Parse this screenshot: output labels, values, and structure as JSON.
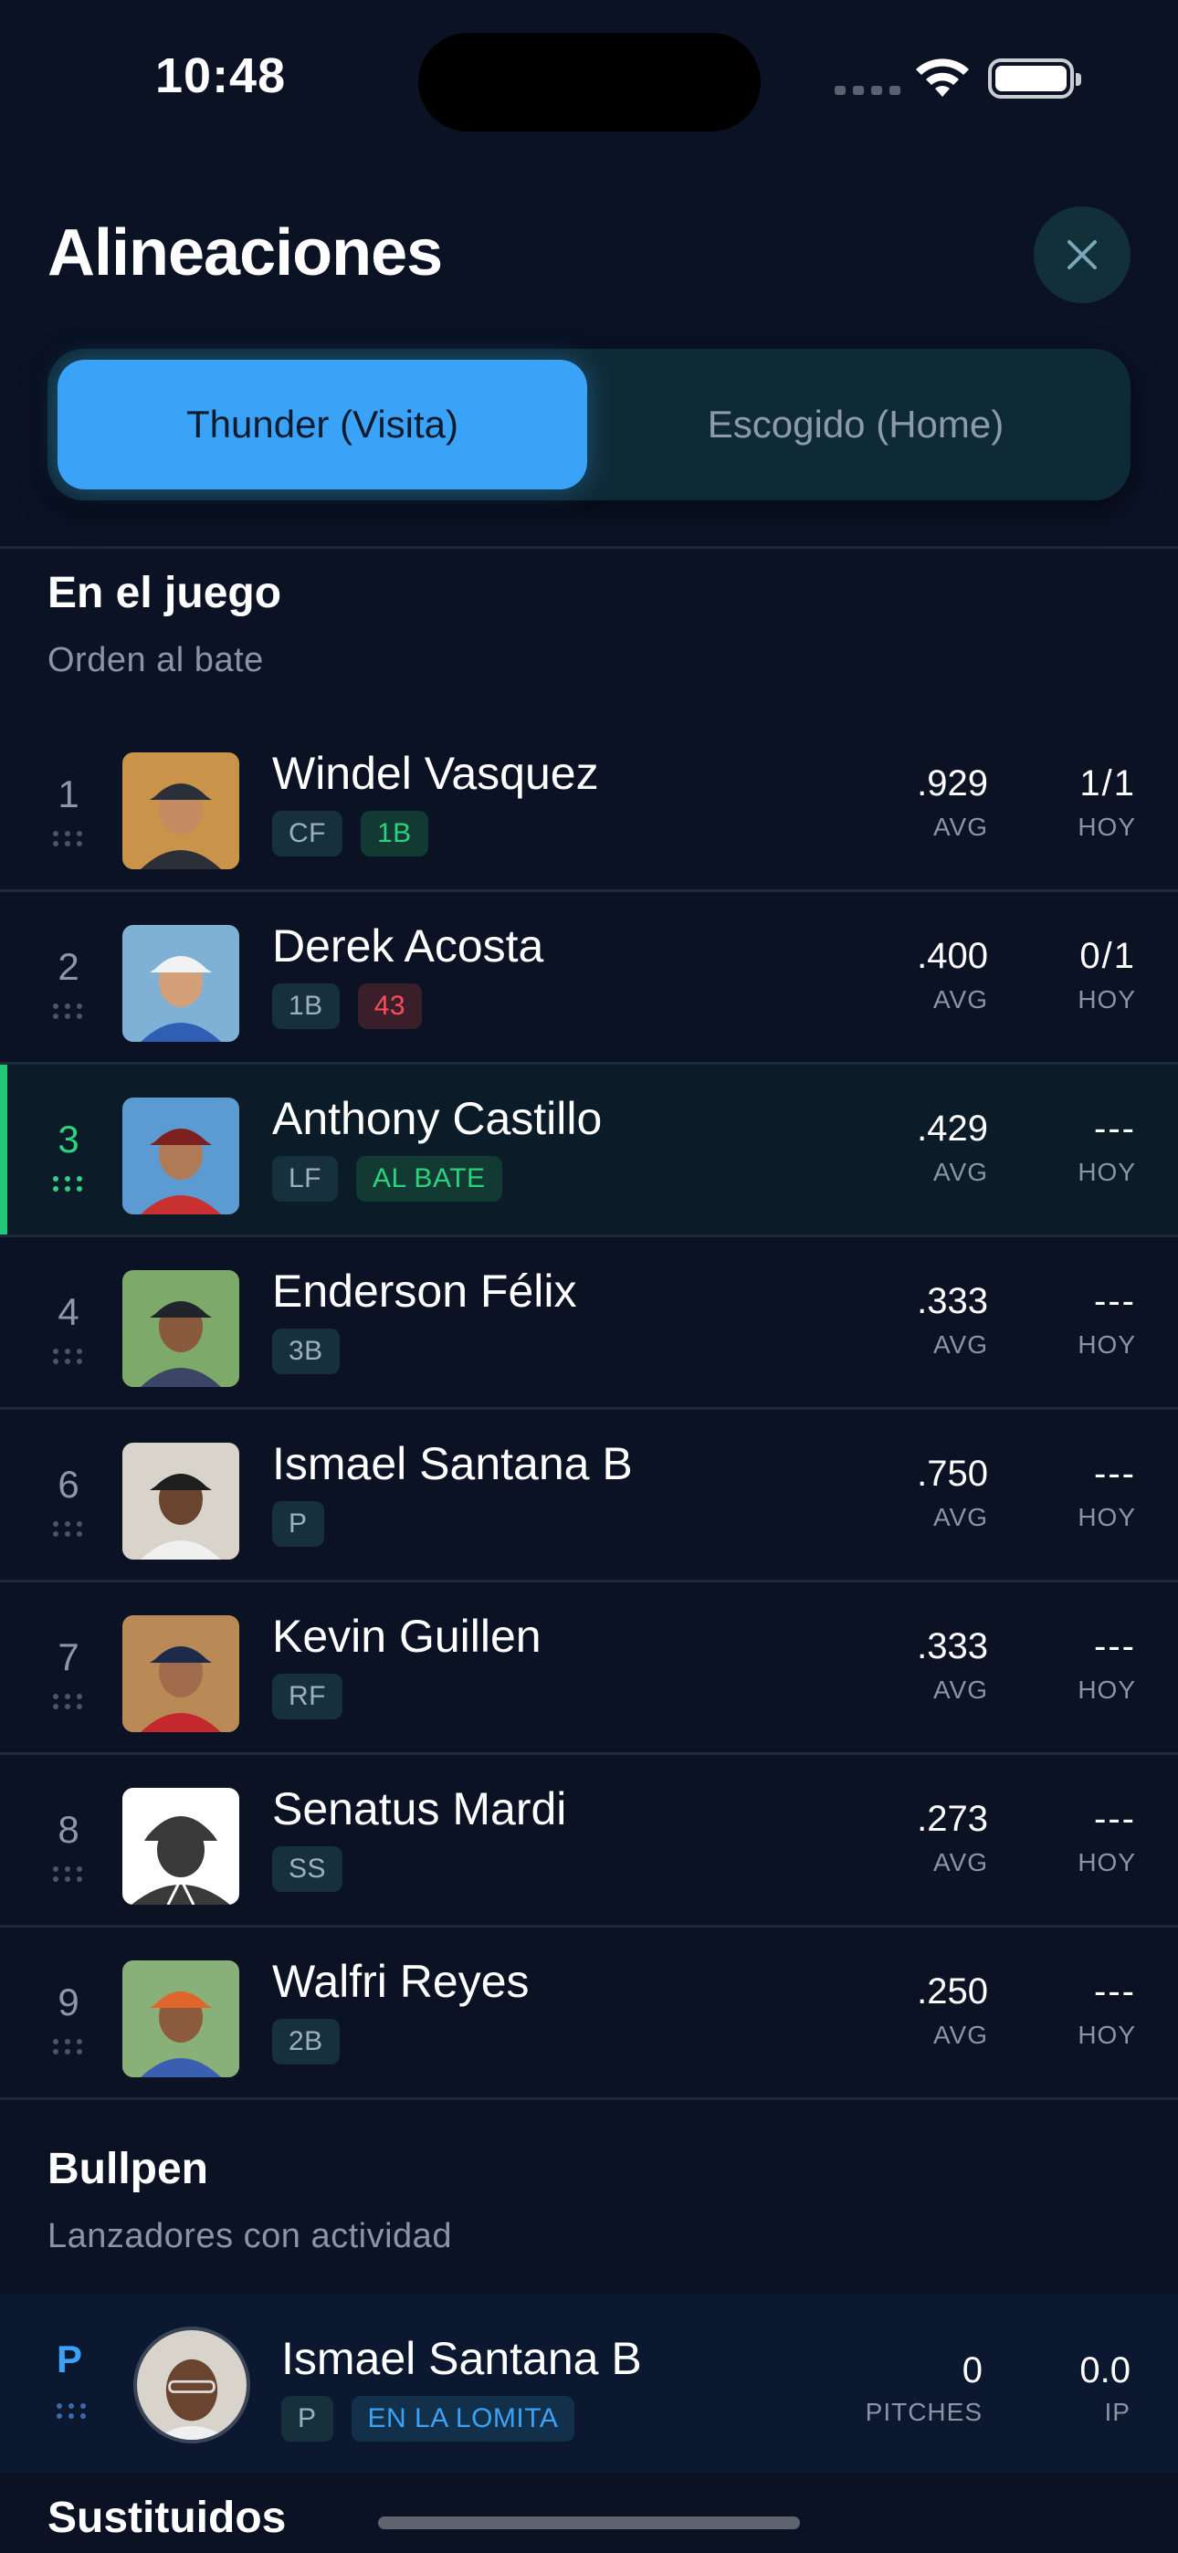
{
  "status_bar": {
    "time": "10:48"
  },
  "header": {
    "title": "Alineaciones"
  },
  "tabs": [
    {
      "label": "Thunder (Visita)",
      "active": true
    },
    {
      "label": "Escogido (Home)",
      "active": false
    }
  ],
  "lineup_section": {
    "title": "En el juego",
    "subtitle": "Orden al bate"
  },
  "players": [
    {
      "order": "1",
      "name": "Windel Vasquez",
      "badges": [
        {
          "text": "CF",
          "style": "default"
        },
        {
          "text": "1B",
          "style": "green"
        }
      ],
      "avg": ".929",
      "avg_label": "AVG",
      "hoy": "1/1",
      "hoy_label": "HOY",
      "active": false,
      "photo": {
        "bg": "#c9944a",
        "cap": "#2a2f3a",
        "shirt": "#2b2f38",
        "skin": "#c48a62"
      }
    },
    {
      "order": "2",
      "name": "Derek Acosta",
      "badges": [
        {
          "text": "1B",
          "style": "default"
        },
        {
          "text": "43",
          "style": "red"
        }
      ],
      "avg": ".400",
      "avg_label": "AVG",
      "hoy": "0/1",
      "hoy_label": "HOY",
      "active": false,
      "photo": {
        "bg": "#7fb0d6",
        "cap": "#f2f2f2",
        "shirt": "#2f5fb5",
        "skin": "#d4a07a"
      }
    },
    {
      "order": "3",
      "name": "Anthony Castillo",
      "badges": [
        {
          "text": "LF",
          "style": "default"
        },
        {
          "text": "AL BATE",
          "style": "green"
        }
      ],
      "avg": ".429",
      "avg_label": "AVG",
      "hoy": "---",
      "hoy_label": "HOY",
      "active": true,
      "photo": {
        "bg": "#5c9bd1",
        "cap": "#7d2020",
        "shirt": "#c93030",
        "skin": "#b07a56"
      }
    },
    {
      "order": "4",
      "name": "Enderson Félix",
      "badges": [
        {
          "text": "3B",
          "style": "default"
        }
      ],
      "avg": ".333",
      "avg_label": "AVG",
      "hoy": "---",
      "hoy_label": "HOY",
      "active": false,
      "photo": {
        "bg": "#7daa6a",
        "cap": "#20242c",
        "shirt": "#3b4566",
        "skin": "#8a5a3e"
      }
    },
    {
      "order": "6",
      "name": "Ismael Santana B",
      "badges": [
        {
          "text": "P",
          "style": "default"
        }
      ],
      "avg": ".750",
      "avg_label": "AVG",
      "hoy": "---",
      "hoy_label": "HOY",
      "active": false,
      "photo": {
        "bg": "#d8d4cc",
        "cap": "#1e1e1e",
        "shirt": "#f0f0f0",
        "skin": "#6b4430"
      }
    },
    {
      "order": "7",
      "name": "Kevin Guillen",
      "badges": [
        {
          "text": "RF",
          "style": "default"
        }
      ],
      "avg": ".333",
      "avg_label": "AVG",
      "hoy": "---",
      "hoy_label": "HOY",
      "active": false,
      "photo": {
        "bg": "#b98a55",
        "cap": "#1d2a4a",
        "shirt": "#c4282e",
        "skin": "#a06c4c"
      }
    },
    {
      "order": "8",
      "name": "Senatus Mardi",
      "badges": [
        {
          "text": "SS",
          "style": "default"
        }
      ],
      "avg": ".273",
      "avg_label": "AVG",
      "hoy": "---",
      "hoy_label": "HOY",
      "active": false,
      "photo": {
        "bg": "#ffffff",
        "cap": "#2d2d2d",
        "shirt": "#2d2d2d",
        "skin": "#3a3a3a",
        "placeholder": true
      }
    },
    {
      "order": "9",
      "name": "Walfri Reyes",
      "badges": [
        {
          "text": "2B",
          "style": "default"
        }
      ],
      "avg": ".250",
      "avg_label": "AVG",
      "hoy": "---",
      "hoy_label": "HOY",
      "active": false,
      "photo": {
        "bg": "#8ab07a",
        "cap": "#e0652a",
        "shirt": "#3a5fb0",
        "skin": "#8c5a3c"
      }
    }
  ],
  "bullpen_section": {
    "title": "Bullpen",
    "subtitle": "Lanzadores con actividad"
  },
  "bullpen": {
    "pos": "P",
    "name": "Ismael Santana B",
    "badges": [
      {
        "text": "P",
        "style": "default"
      },
      {
        "text": "EN LA LOMITA",
        "style": "blue"
      }
    ],
    "pitches": "0",
    "pitches_label": "PITCHES",
    "ip": "0.0",
    "ip_label": "IP"
  },
  "substitutes_section": {
    "title": "Sustituidos"
  }
}
